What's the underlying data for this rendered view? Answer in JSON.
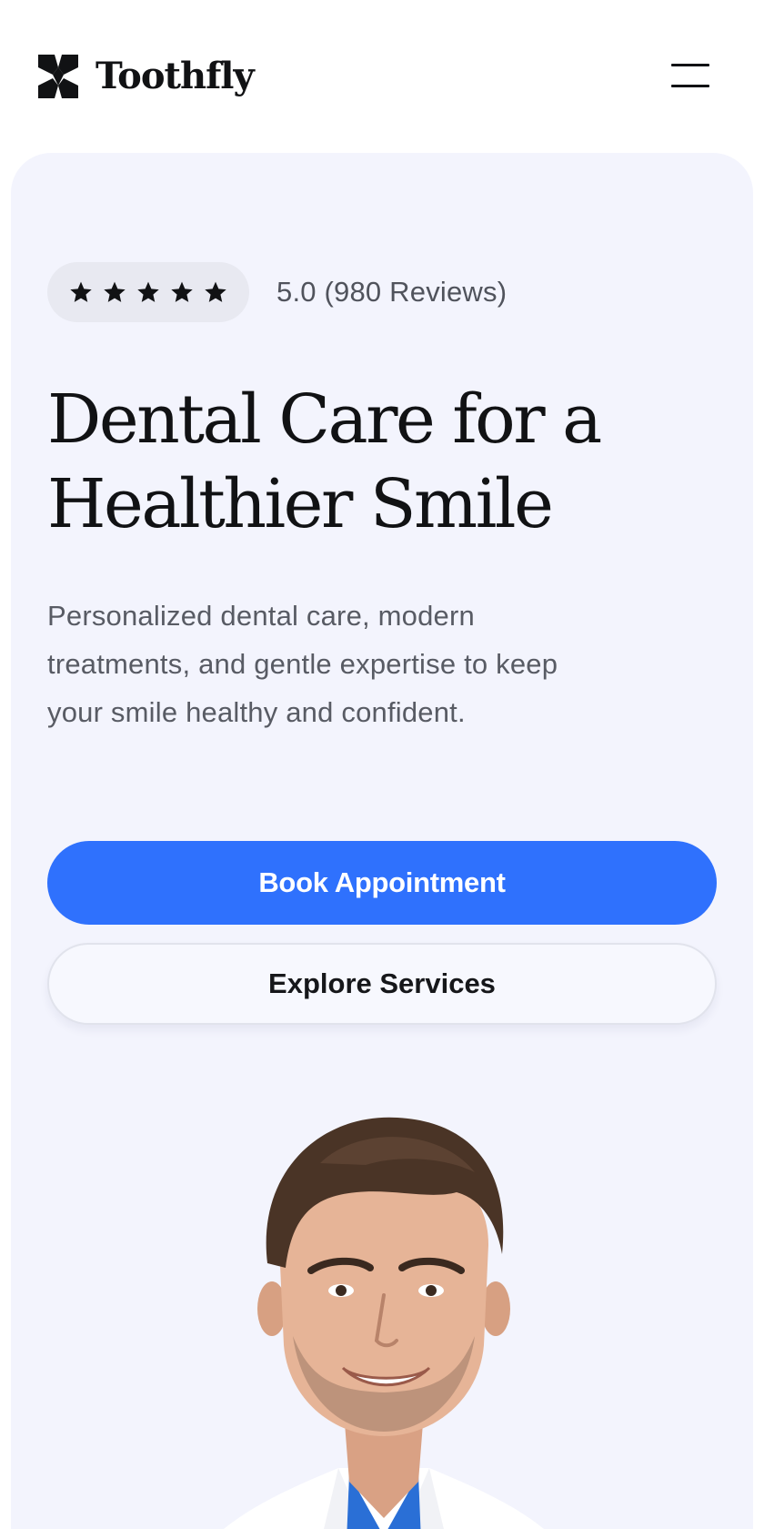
{
  "header": {
    "brand": "Toothfly",
    "logo_icon": "pinwheel-logo-icon",
    "menu_icon": "hamburger-menu-icon"
  },
  "hero": {
    "rating": {
      "stars": 5,
      "text": "5.0 (980 Reviews)"
    },
    "title_line1": "Dental Care for a",
    "title_line2": "Healthier Smile",
    "subtitle_line1": "Personalized dental care, modern",
    "subtitle_line2": "treatments, and gentle expertise to keep",
    "subtitle_line3": "your smile healthy and confident.",
    "primary_button": "Book Appointment",
    "secondary_button": "Explore Services"
  },
  "colors": {
    "accent": "#2f71fd",
    "hero_background": "#f3f4fd",
    "text_dark": "#111214",
    "text_muted": "#585b64"
  }
}
